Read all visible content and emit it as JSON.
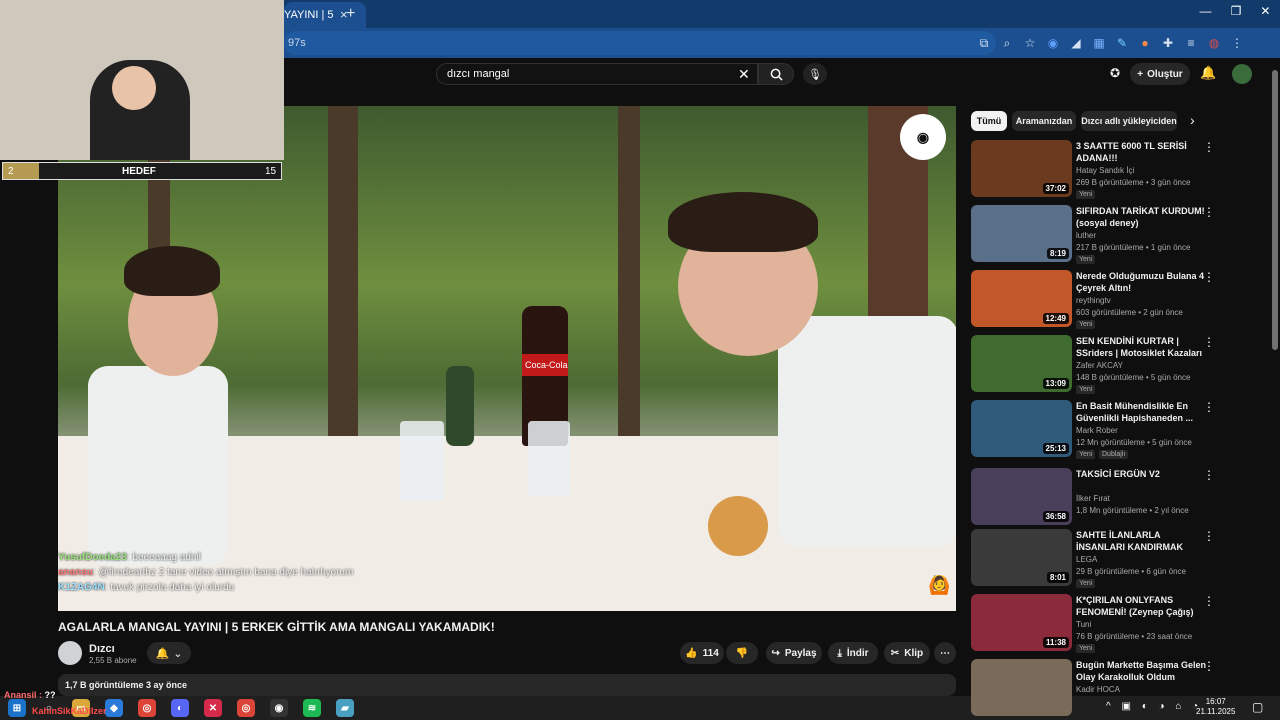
{
  "browser": {
    "tab_title": "YAYINI | 5",
    "tab_close": "×",
    "new_tab": "+",
    "url_fragment": "97s",
    "window_controls": [
      "—",
      "❐",
      "✕"
    ]
  },
  "youtube": {
    "search_value": "dızcı mangal",
    "create_label": "Oluştur",
    "video_title": "AGALARLA MANGAL YAYINI | 5 ERKEK GİTTİK AMA MANGALI YAKAMADIK!",
    "channel_name": "Dızcı",
    "channel_subs": "2,55 B abone",
    "like_count": "114",
    "share_label": "Paylaş",
    "download_label": "İndir",
    "clip_label": "Klip",
    "description_meta": "1,7 B görüntüleme  3 ay önce"
  },
  "video_overlay": {
    "cola_text": "Coca-Cola",
    "chat": [
      {
        "name": "YusufDoeda23",
        "text": "beeeaaag adnil"
      },
      {
        "name": "anansu",
        "text": "@firedearthz 2 tane video atmıştın bana diye hatırlıyorum"
      },
      {
        "name": "K1ZAG4N",
        "text": "tavuk pirzola daha iyi olurdu"
      }
    ]
  },
  "stream": {
    "goal_current": "2",
    "goal_title": "HEDEF",
    "goal_target": "15",
    "goal_progress": 0.13,
    "viewer_name": "Anansil",
    "viewer_text": "??",
    "viewer_line2": "KahinSikKaDiIzer"
  },
  "sidebar": {
    "chips": [
      "Tümü",
      "Aramanızdan",
      "Dızcı adlı yükleyiciden"
    ],
    "chip_next": "›",
    "items": [
      {
        "title": "3 SAATTE 6000 TL SERİSİ ADANA!!!",
        "channel": "Hatay Sandık İçi",
        "meta": "269 B görüntüleme • 3 gün önce",
        "badge": "Yeni",
        "duration": "37:02",
        "color": "#6b3a1f"
      },
      {
        "title": "SIFIRDAN TARİKAT KURDUM! (sosyal deney)",
        "channel": "luther",
        "meta": "217 B görüntüleme • 1 gün önce",
        "badge": "Yeni",
        "duration": "8:19",
        "color": "#5a6f8a"
      },
      {
        "title": "Nerede Olduğumuzu Bulana 4 Çeyrek Altın!",
        "channel": "reythingtv",
        "meta": "603 görüntüleme • 2 gün önce",
        "badge": "Yeni",
        "duration": "12:49",
        "color": "#c2572a"
      },
      {
        "title": "SEN KENDİNİ KURTAR | SSriders | Motosiklet Kazaları ...",
        "channel": "Zafer AKCAY",
        "meta": "148 B görüntüleme • 5 gün önce",
        "badge": "Yeni",
        "duration": "13:09",
        "color": "#3f6b2f"
      },
      {
        "title": "En Basit Mühendislikle En Güvenlikli Hapishaneden ...",
        "channel": "Mark Rober",
        "meta": "12 Mn görüntüleme • 5 gün önce",
        "badge": "Yeni",
        "badge2": "Dublajlı",
        "duration": "25:13",
        "color": "#2f5a7a"
      },
      {
        "title": "TAKSİCİ ERGÜN V2",
        "channel": "İlker Fırat",
        "meta": "1,8 Mn görüntüleme • 2 yıl önce",
        "badge": "",
        "duration": "36:58",
        "color": "#4a3f5a"
      },
      {
        "title": "SAHTE İLANLARLA İNSANLARI KANDIRMAK",
        "channel": "LEGA",
        "meta": "29 B görüntüleme • 6 gün önce",
        "badge": "Yeni",
        "duration": "8:01",
        "color": "#3a3a3a"
      },
      {
        "title": "K*ÇIRILAN ONLYFANS FENOMENİ! (Zeynep Çağış)",
        "channel": "Tuni",
        "meta": "76 B görüntüleme • 23 saat önce",
        "badge": "Yeni",
        "duration": "11:38",
        "color": "#8a2a3a"
      },
      {
        "title": "Bugün Markette Başıma Gelen Olay Karakolluk Oldum",
        "channel": "Kadir HOCA",
        "meta": "",
        "badge": "",
        "duration": "",
        "color": "#7a6a5a"
      }
    ]
  },
  "taskbar": {
    "time": "16:07",
    "date": "21.11.2025",
    "tray": "^ ▣ ◐ ◑ ⌂ ◔"
  },
  "colors": {
    "accent": "#ff0000",
    "chat_name": "#9be07d"
  }
}
